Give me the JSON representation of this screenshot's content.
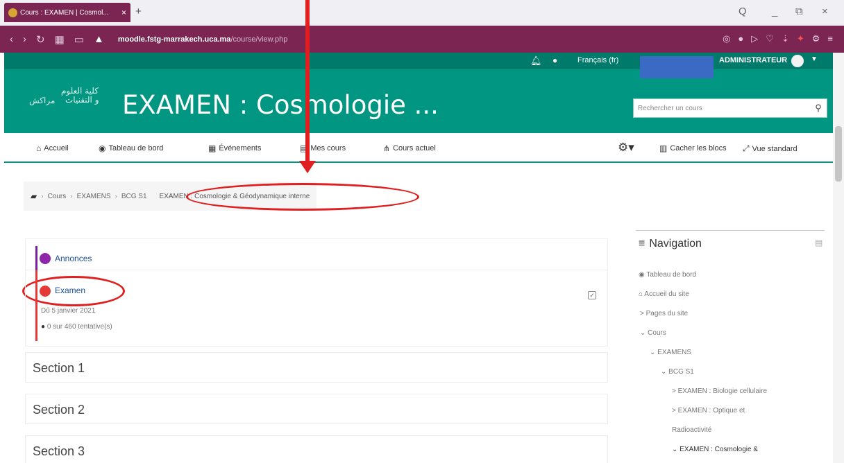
{
  "browser": {
    "tab_title": "Cours : EXAMEN | Cosmol...",
    "tab_close": "×",
    "new_tab": "+",
    "url_host": "moodle.fstg-marrakech.uca.ma",
    "url_path": "/course/view.php",
    "controls": [
      "Q",
      "_",
      "⧉",
      "×"
    ]
  },
  "topbar": {
    "language": "Français (fr)",
    "user": "ADMINISTRATEUR"
  },
  "header": {
    "logo_line1": "كلية العلوم",
    "logo_line2": "و التقنيات",
    "logo_line3": "مراكش",
    "course_title": "EXAMEN : Cosmologie ...",
    "search_placeholder": "Rechercher un cours"
  },
  "nav": {
    "accueil": "Accueil",
    "tableau": "Tableau de bord",
    "evenements": "Événements",
    "mes_cours": "Mes cours",
    "cours_actuel": "Cours actuel",
    "cacher": "Cacher les blocs",
    "vue": "Vue standard"
  },
  "breadcrumb": {
    "items": [
      "Cours",
      "EXAMENS",
      "BCG S1"
    ],
    "current": "EXAMEN : Cosmologie & Géodynamique interne"
  },
  "content": {
    "annonces": "Annonces",
    "examen": "Examen",
    "due": "Dû 5 janvier 2021",
    "attempts": "0 sur 460 tentative(s)",
    "sections": [
      "Section 1",
      "Section 2",
      "Section 3"
    ]
  },
  "navigation": {
    "title": "Navigation",
    "items": [
      {
        "label": "Tableau de bord",
        "prefix": ""
      },
      {
        "label": "Accueil du site",
        "prefix": ""
      },
      {
        "label": "Pages du site",
        "prefix": ">"
      },
      {
        "label": "Cours",
        "prefix": "⌄"
      },
      {
        "label": "EXAMENS",
        "prefix": "⌄"
      },
      {
        "label": "BCG S1",
        "prefix": "⌄"
      },
      {
        "label": "EXAMEN : Biologie cellulaire",
        "prefix": ">"
      },
      {
        "label": "EXAMEN : Optique et",
        "prefix": ">"
      },
      {
        "label": "Radioactivité",
        "prefix": ""
      },
      {
        "label": "EXAMEN : Cosmologie &",
        "prefix": "⌄"
      }
    ]
  },
  "colors": {
    "brand": "#009682",
    "browser": "#7b2553",
    "annotation": "#e02020"
  }
}
